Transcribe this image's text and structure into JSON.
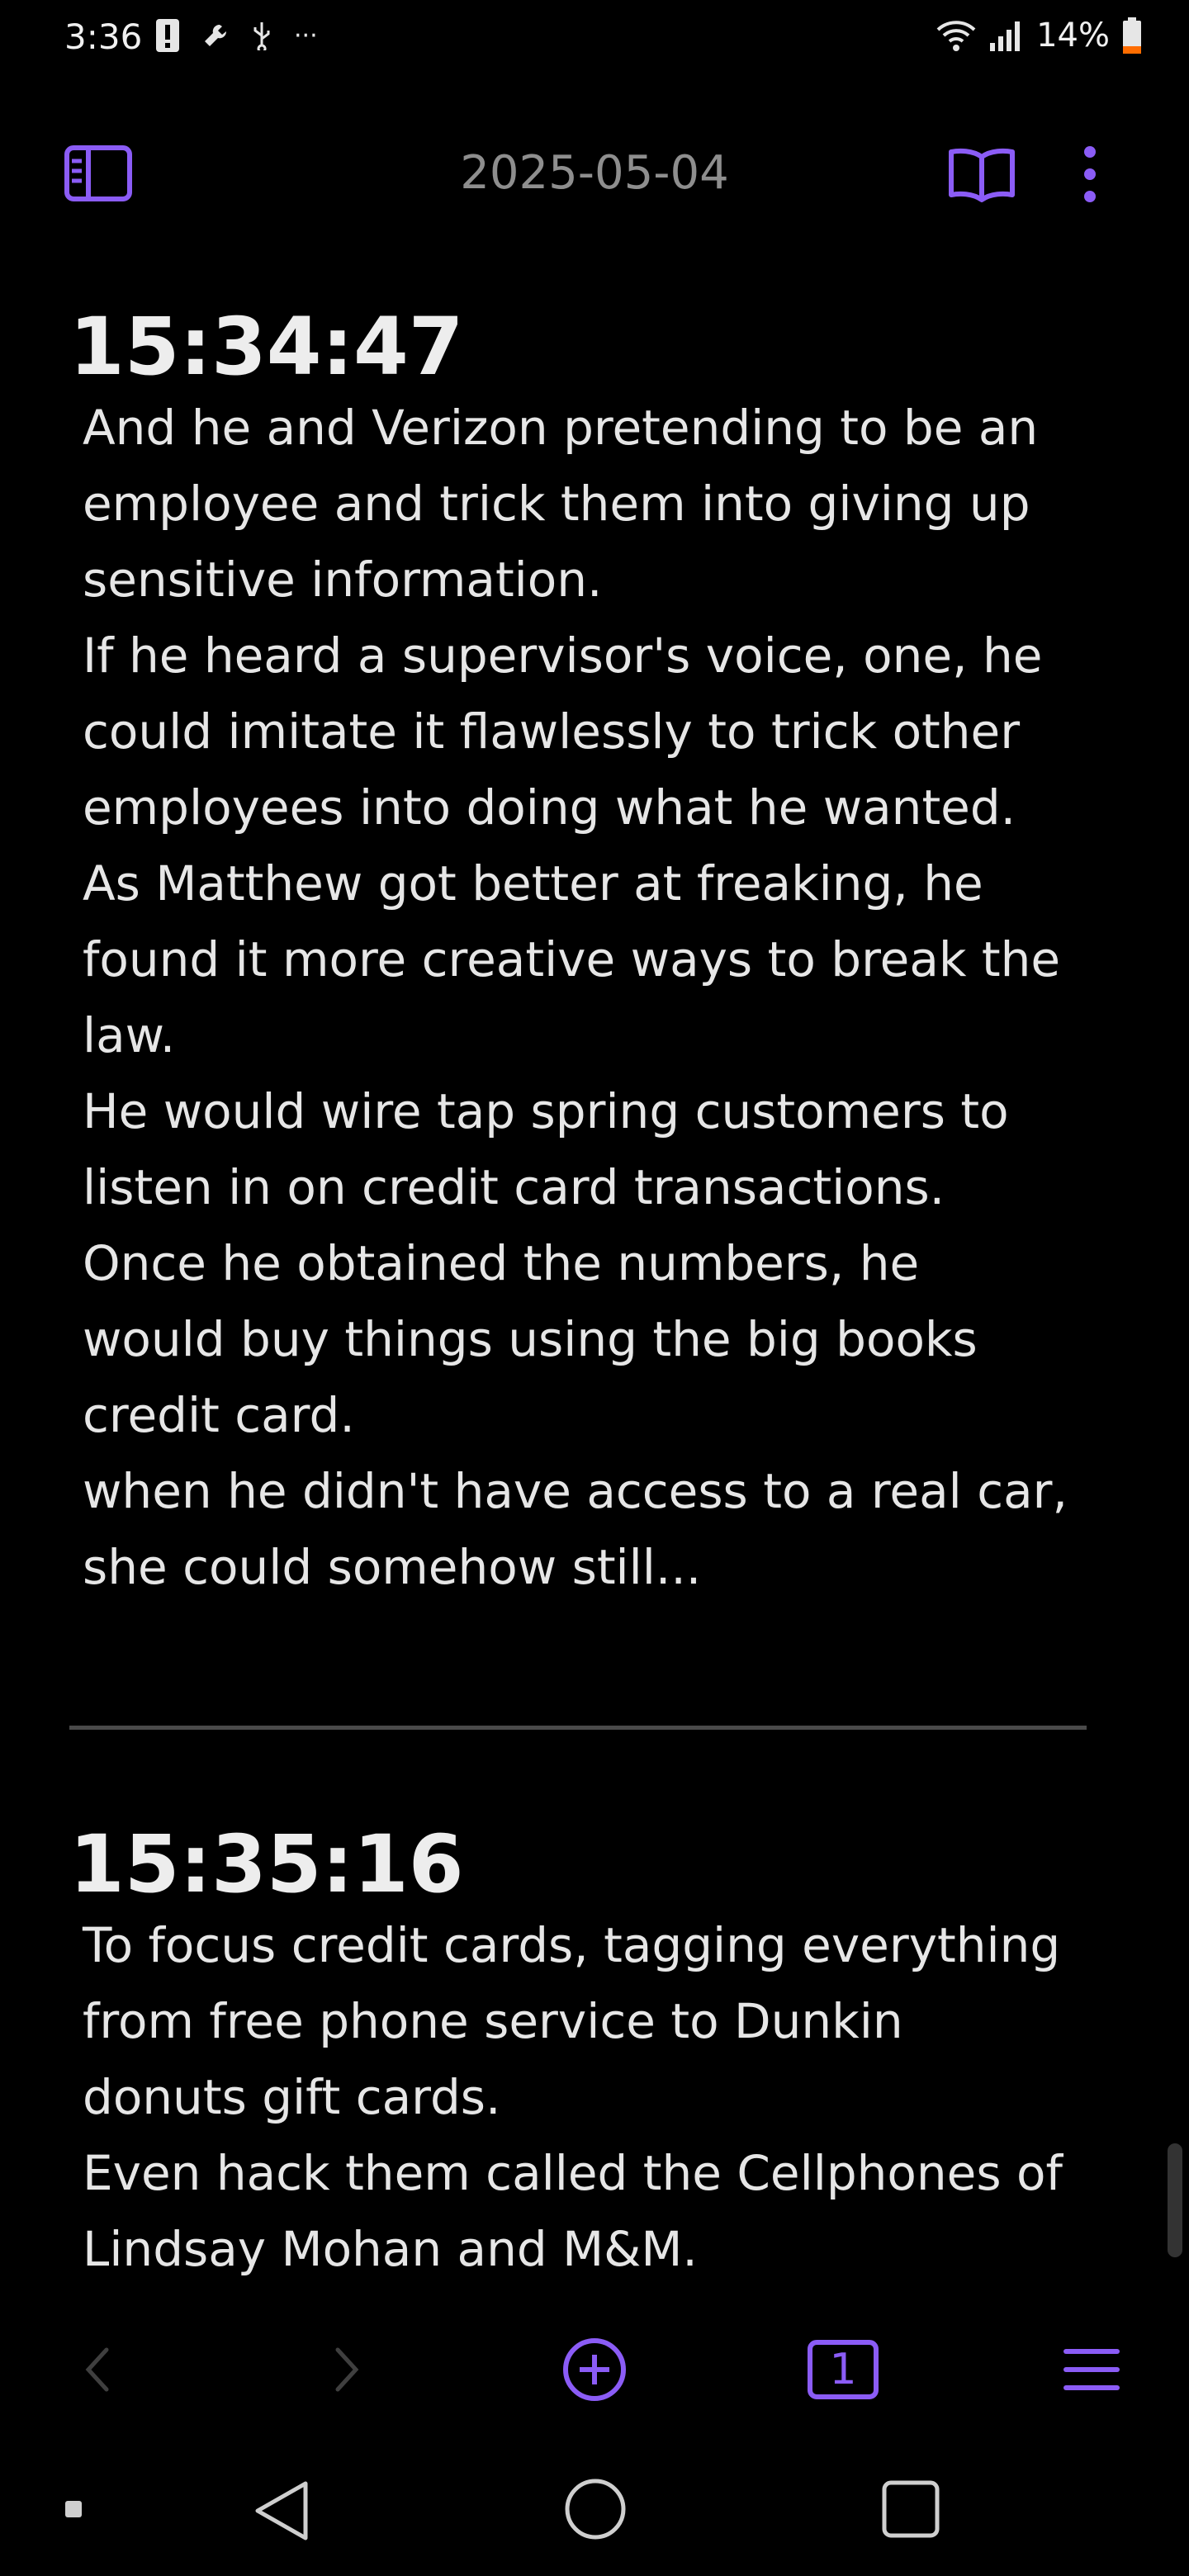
{
  "status_bar": {
    "time": "3:36",
    "battery_pct": "14%",
    "left_icons": [
      "alert-icon",
      "wrench-icon",
      "usb-icon",
      "more-notifications-icon"
    ],
    "right_icons": [
      "wifi-icon",
      "signal-icon",
      "battery-icon"
    ]
  },
  "app_bar": {
    "title": "2025-05-04",
    "icons": [
      "sidebar-toggle-icon",
      "reading-mode-icon",
      "more-options-icon"
    ]
  },
  "entries": [
    {
      "time": "15:34:47",
      "lines": [
        "And he and Verizon pretending to be an",
        "employee and trick them into giving up",
        "sensitive information.",
        "If he heard a supervisor's voice, one, he",
        "could imitate it flawlessly to trick other",
        "employees into doing what he wanted.",
        "As Matthew got better at freaking, he",
        "found it more creative ways to break the",
        "law.",
        "He would wire tap spring customers to",
        "listen in on credit card transactions.",
        "Once he obtained the numbers, he",
        "would buy things using the big books",
        "credit card.",
        "when he didn't have access to a real car,",
        "she could somehow still..."
      ]
    },
    {
      "time": "15:35:16",
      "lines": [
        "To focus credit cards, tagging everything",
        "from free phone service to Dunkin",
        "donuts gift cards.",
        "Even hack them called the Cellphones of",
        "Lindsay Mohan and M&M."
      ]
    }
  ],
  "bottom_toolbar": {
    "tab_count": "1",
    "icons": [
      "back-arrow-icon",
      "forward-arrow-icon",
      "new-note-icon",
      "tabs-icon",
      "menu-icon"
    ]
  },
  "nav_bar": {
    "icons": [
      "recent-indicator-icon",
      "nav-back-icon",
      "nav-home-icon",
      "nav-overview-icon"
    ]
  },
  "colors": {
    "background": "#000000",
    "accent": "#8b5cf6",
    "text": "#e6e6e6",
    "title": "#8e8e8e",
    "battery_low": "#ff6d00"
  }
}
